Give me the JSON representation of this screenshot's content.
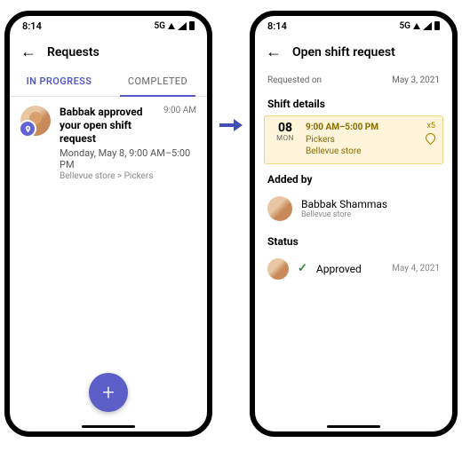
{
  "status": {
    "time": "8:14",
    "network": "5G"
  },
  "left": {
    "header_title": "Requests",
    "tabs": {
      "in_progress": "IN PROGRESS",
      "completed": "COMPLETED"
    },
    "request": {
      "title": "Babbak approved your open shift request",
      "subtitle": "Monday, May 8, 9:00 AM–5:00 PM",
      "meta": "Bellevue store > Pickers",
      "time": "9:00 AM"
    }
  },
  "right": {
    "header_title": "Open shift request",
    "requested_on_label": "Requested on",
    "requested_on_value": "May 3, 2021",
    "shift_details_label": "Shift details",
    "shift": {
      "day_num": "08",
      "day_dow": "MON",
      "time": "9:00 AM–5:00 PM",
      "group": "Pickers",
      "store": "Bellevue store",
      "count": "x5"
    },
    "added_by_label": "Added by",
    "added_by": {
      "name": "Babbak Shammas",
      "meta": "Bellevue store"
    },
    "status_label": "Status",
    "status": {
      "text": "Approved",
      "date": "May 4, 2021"
    }
  }
}
